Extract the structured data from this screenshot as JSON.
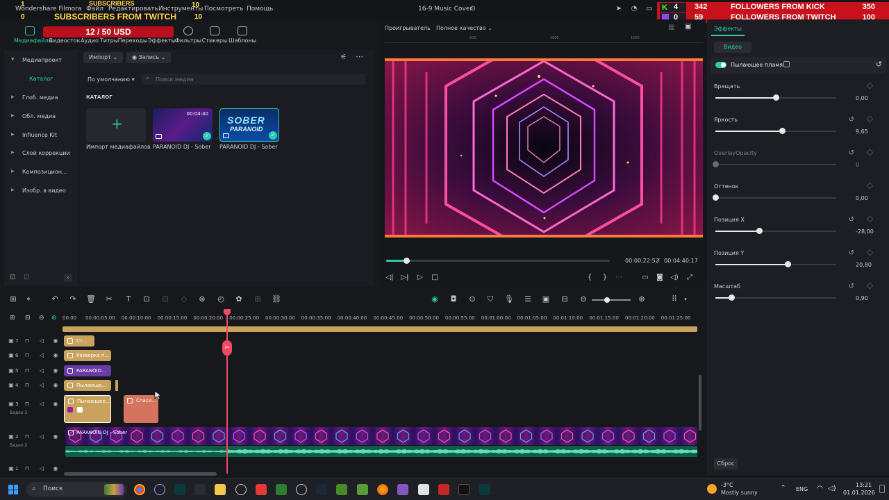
{
  "app": {
    "brand": "Wondershare Filmora",
    "project_title": "16-9 Music Cover"
  },
  "menu": [
    "Файл",
    "Редактировать",
    "Инструменты",
    "Посмотреть",
    "Помощь"
  ],
  "overlay": {
    "subs_count": "1",
    "subs_label": "SUBSCRIBERS",
    "subs_count2": "10",
    "twitch_label": "SUBSCRIBERS FROM TWITCH",
    "twitch_left": "0",
    "twitch_right": "10",
    "price": "12 / 50 USD",
    "kick_prefix": "4",
    "kick_count": "342",
    "kick_label": "FOLLOWERS FROM KICK",
    "kick_total": "350",
    "tw_prefix": "0",
    "tw_count": "59",
    "tw_label": "FOLLOWERS FROM TWITCH",
    "tw_total": "100"
  },
  "media_tabs": [
    {
      "label": "Медиафайлы",
      "icon": "media-icon"
    },
    {
      "label": "Видеосток",
      "icon": "stock-icon"
    },
    {
      "label": "Аудио",
      "icon": "audio-icon"
    },
    {
      "label": "Титры",
      "icon": "titles-icon"
    },
    {
      "label": "Переходы",
      "icon": "transitions-icon"
    },
    {
      "label": "Эффекты",
      "icon": "effects-icon"
    },
    {
      "label": "Фильтры",
      "icon": "filters-icon"
    },
    {
      "label": "Стикеры",
      "icon": "stickers-icon"
    },
    {
      "label": "Шаблоны",
      "icon": "templates-icon"
    }
  ],
  "left_panel": {
    "header": "Медиапроект",
    "selected": "Каталог",
    "items": [
      "Глоб. медиа",
      "Обл. медиа",
      "Influence Kit",
      "Слой коррекции",
      "Композицион...",
      "Изобр. в видео"
    ]
  },
  "media": {
    "import_btn": "Импорт",
    "record_btn": "Запись",
    "sort": "По умолчанию",
    "search_placeholder": "Поиск медиа",
    "catalog_header": "КАТАЛОГ",
    "tiles": [
      {
        "label": "Импорт медиафайлов"
      },
      {
        "label": "PARANOID DJ - Sober",
        "duration": "00:04:40"
      },
      {
        "label": "PARANOID DJ - Sober",
        "thumb_text_1": "SOBER",
        "thumb_text_2": "PARANOID"
      }
    ]
  },
  "player": {
    "label": "Проигрыватель",
    "quality": "Полное качество",
    "ruler": [
      "500",
      "1000",
      "1500"
    ],
    "current_time": "00:00:22:52",
    "separator": "/",
    "total_time": "00:04:40:17",
    "progress": 0.09
  },
  "effects": {
    "tab": "Эффекты",
    "sub_tab": "Видео",
    "effect_name": "Пылающее пламя",
    "params": [
      {
        "label": "Вращать",
        "value": "0,00",
        "fraction": 0.5
      },
      {
        "label": "Яркость",
        "value": "9,65",
        "fraction": 0.55
      },
      {
        "label": "OverlayOpacity",
        "value": "0",
        "fraction": 0.0,
        "disabled": true
      },
      {
        "label": "Оттенок",
        "value": "0,00",
        "fraction": 0.0
      },
      {
        "label": "Позиция X",
        "value": "-28,00",
        "fraction": 0.36
      },
      {
        "label": "Позиция Y",
        "value": "20,80",
        "fraction": 0.6
      },
      {
        "label": "Масштаб",
        "value": "0,90",
        "fraction": 0.13
      }
    ],
    "reset": "Сброс"
  },
  "timeline": {
    "ticks": [
      "00:00",
      "00:00:05:00",
      "00:00:10:00",
      "00:00:15:00",
      "00:00:20:00",
      "00:00:25:00",
      "00:00:30:00",
      "00:00:35:00",
      "00:00:40:00",
      "00:00:45:00",
      "00:00:50:00",
      "00:00:55:00",
      "00:01:00:00",
      "00:01:05:00",
      "00:01:10:00",
      "00:01:15:00",
      "00:01:20:00",
      "00:01:25:00"
    ],
    "tracks": [
      {
        "num": "7"
      },
      {
        "num": "6"
      },
      {
        "num": "5"
      },
      {
        "num": "4"
      },
      {
        "num": "3",
        "name": "Видео 3"
      },
      {
        "num": "2",
        "name": "Видео 2"
      },
      {
        "num": "1"
      }
    ],
    "clips": {
      "t7": "Ст...",
      "t6": "Разверка п...",
      "t5": "PARANOID...",
      "t4": "Пылающе...",
      "t3a": "Пылающее...",
      "t3b": "Спаси...",
      "t2": "PARANOID DJ - Sober"
    }
  },
  "taskbar": {
    "search": "Поиск",
    "weather_temp": "-3°C",
    "weather_desc": "Mostly sunny",
    "lang": "ENG",
    "time": "13:21",
    "date": "01.01.2026"
  },
  "colors": {
    "accent": "#2ecbb0",
    "playhead": "#ef4a63",
    "overlay_red": "#c8111b"
  }
}
